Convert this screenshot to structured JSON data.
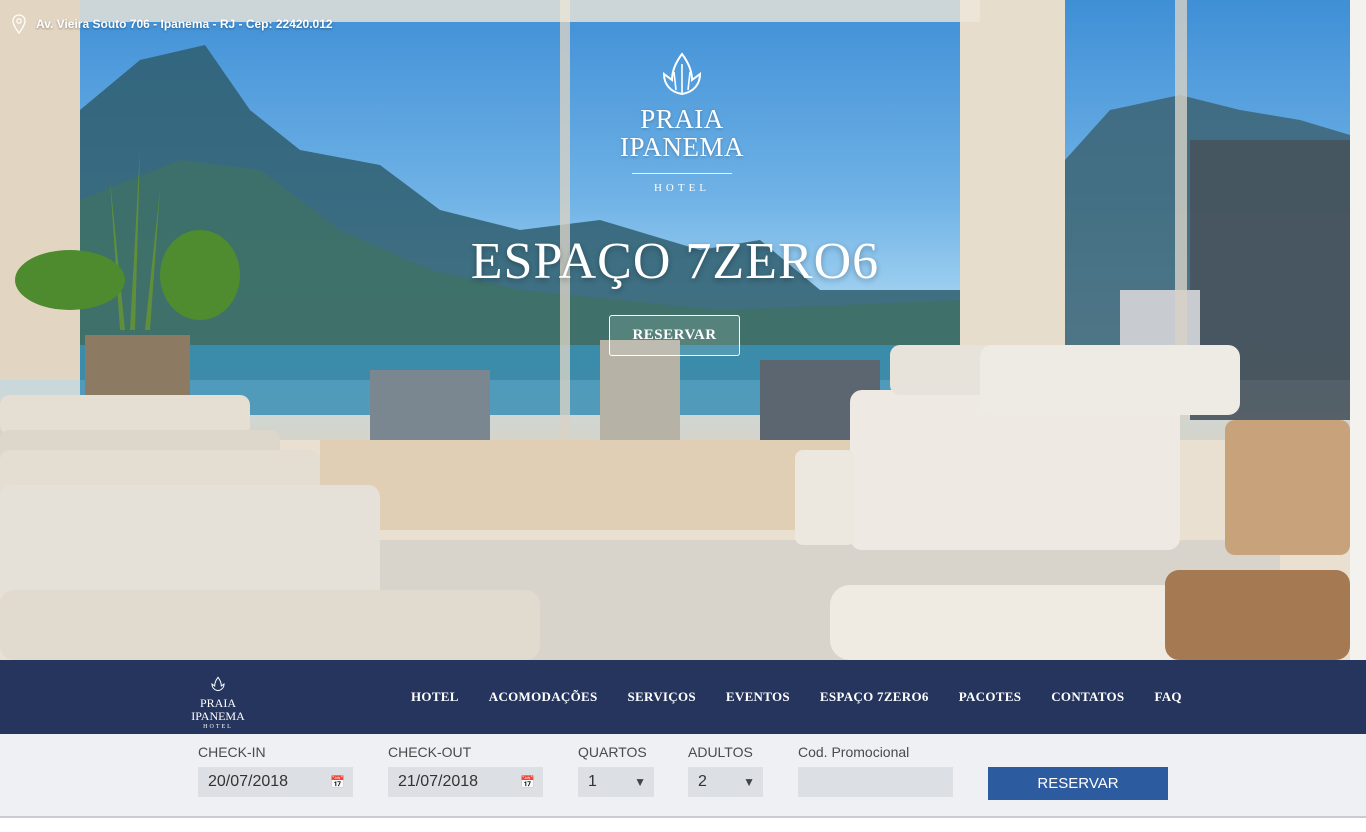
{
  "header": {
    "address": "Av. Vieira Souto 706 - Ipanema - RJ - Cep: 22420.012",
    "icon": "map-pin-icon"
  },
  "logo": {
    "name": "PRAIA IPANEMA",
    "sub": "HOTEL"
  },
  "hero": {
    "title": "ESPAÇO 7ZERO6",
    "button_label": "RESERVAR"
  },
  "nav": {
    "items": [
      {
        "label": "HOTEL"
      },
      {
        "label": "ACOMODAÇÕES"
      },
      {
        "label": "SERVIÇOS"
      },
      {
        "label": "EVENTOS"
      },
      {
        "label": "ESPAÇO 7ZERO6"
      },
      {
        "label": "PACOTES"
      },
      {
        "label": "CONTATOS"
      },
      {
        "label": "FAQ"
      }
    ]
  },
  "booking": {
    "checkin": {
      "label": "CHECK-IN",
      "value": "20/07/2018",
      "icon": "calendar-icon"
    },
    "checkout": {
      "label": "CHECK-OUT",
      "value": "21/07/2018",
      "icon": "calendar-icon"
    },
    "rooms": {
      "label": "QUARTOS",
      "value": "1",
      "icon": "dropdown-arrow-icon"
    },
    "adults": {
      "label": "ADULTOS",
      "value": "2",
      "icon": "dropdown-arrow-icon"
    },
    "promo": {
      "label": "Cod. Promocional",
      "value": ""
    },
    "button_label": "RESERVAR"
  },
  "colors": {
    "navbar": "#25355e",
    "booking_bg": "#eef0f4",
    "button": "#2c5c9f"
  }
}
